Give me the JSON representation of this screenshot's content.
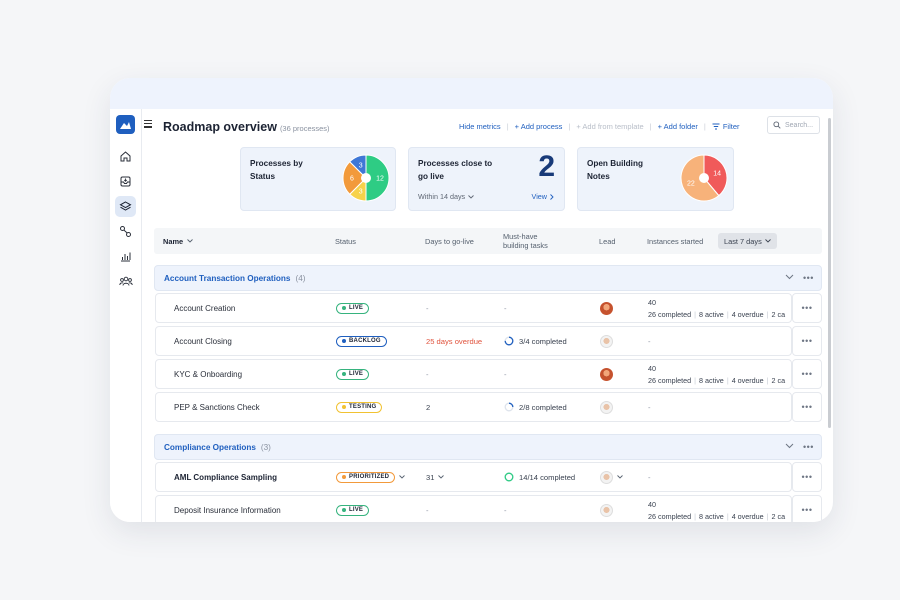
{
  "header": {
    "title": "Roadmap overview",
    "count": "(36 processes)",
    "actions": [
      "Hide metrics",
      "+ Add process",
      "+ Add from template",
      "+ Add folder",
      "Filter"
    ],
    "search_placeholder": "Search..."
  },
  "metrics": {
    "status": {
      "label": "Processes by Status",
      "slices": [
        {
          "value": 12,
          "color": "#2ecc84"
        },
        {
          "value": 3,
          "color": "#f7d24a"
        },
        {
          "value": 6,
          "color": "#f29a3b"
        },
        {
          "value": 3,
          "color": "#3f77d6"
        }
      ]
    },
    "golive": {
      "label": "Processes close to go live",
      "value": "2",
      "window": "Within 14 days",
      "view": "View"
    },
    "notes": {
      "label": "Open Building Notes",
      "slices": [
        {
          "value": 14,
          "color": "#f05a5a"
        },
        {
          "value": 22,
          "color": "#f7b27a"
        }
      ]
    }
  },
  "table": {
    "headers": {
      "name": "Name",
      "status": "Status",
      "days": "Days to go-live",
      "tasks": "Must-have building tasks",
      "lead": "Lead",
      "instances": "Instances started",
      "range": "Last 7 days"
    }
  },
  "groups": [
    {
      "name": "Account Transaction Operations",
      "count": "(4)",
      "rows": [
        {
          "name": "Account Creation",
          "status": "LIVE",
          "days": "-",
          "tasks": "-",
          "inst_total": "40",
          "inst_completed": "26 completed",
          "inst_active": "8 active",
          "inst_overdue": "4 overdue",
          "inst_more": "2 ca"
        },
        {
          "name": "Account Closing",
          "status": "BACKLOG",
          "days": "25 days overdue",
          "tasks": "3/4 completed",
          "inst_dash": "-"
        },
        {
          "name": "KYC & Onboarding",
          "status": "LIVE",
          "days": "-",
          "tasks": "-",
          "inst_total": "40",
          "inst_completed": "26 completed",
          "inst_active": "8 active",
          "inst_overdue": "4 overdue",
          "inst_more": "2 ca"
        },
        {
          "name": "PEP & Sanctions Check",
          "status": "TESTING",
          "days": "2",
          "tasks": "2/8 completed",
          "inst_dash": "-"
        }
      ]
    },
    {
      "name": "Compliance Operations",
      "count": "(3)",
      "rows": [
        {
          "name": "AML Compliance Sampling",
          "status": "PRIORITIZED",
          "days": "31",
          "tasks": "14/14 completed",
          "inst_dash": "-"
        },
        {
          "name": "Deposit Insurance Information",
          "status": "LIVE",
          "days": "-",
          "tasks": "-",
          "inst_total": "40",
          "inst_completed": "26 completed",
          "inst_active": "8 active",
          "inst_overdue": "4 overdue",
          "inst_more": "2 ca"
        }
      ]
    }
  ]
}
